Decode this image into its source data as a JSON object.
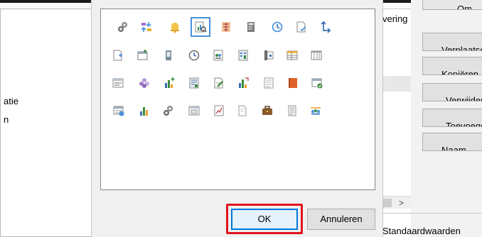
{
  "background": {
    "left_texts": [
      "atie",
      "n"
    ],
    "mid_text": "vering",
    "bottom_text": "Standaardwaarden",
    "scroll_arrow": ">",
    "side_buttons": [
      "Om",
      "Verplaatsen",
      "Kopiëren",
      "Verwijderen",
      "Toevoegen",
      "Naam"
    ]
  },
  "dialog": {
    "ok_label": "OK",
    "cancel_label": "Annuleren",
    "selected_icon": "chart-document-icon",
    "icons": [
      "gears-icon",
      "sort-arrows-icon",
      "bell-icon",
      "chart-document-icon",
      "chinese-character-icon",
      "calculator-icon",
      "clock-refresh-icon",
      "document-check-icon",
      "network-arrow-icon",
      "document-arrow-icon",
      "window-plus-icon",
      "phone-icon",
      "clock-icon",
      "people-document-icon",
      "calculator-grid-icon",
      "door-exit-icon",
      "table-yellow-icon",
      "columns-icon",
      "form-list-icon",
      "purple-flower-icon",
      "bar-chart-plus-icon",
      "document-list-icon",
      "document-pen-icon",
      "bar-chart-arrow-icon",
      "document-lines-icon",
      "orange-book-icon",
      "table-check-icon",
      "table-refresh-icon",
      "bar-chart-icon",
      "gears-small-icon",
      "window-list-icon",
      "line-chart-document-icon",
      "page-icon",
      "briefcase-icon",
      "notepad-icon",
      "people-group-icon"
    ]
  }
}
